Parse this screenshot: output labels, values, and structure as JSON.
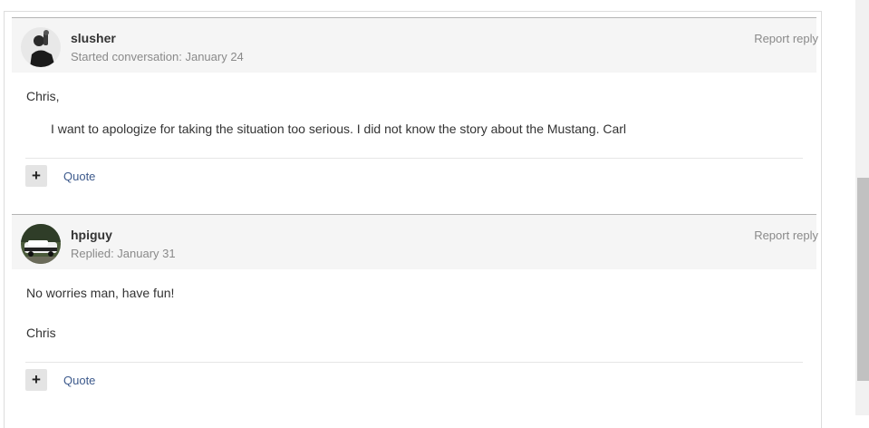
{
  "posts": [
    {
      "username": "slusher",
      "meta": "Started conversation: January 24",
      "report_label": "Report reply",
      "lines": [
        "Chris,"
      ],
      "quote": "I want to apologize for taking the situation too serious. I did not know the story about the Mustang. Carl",
      "plus_label": "+",
      "quote_label": "Quote"
    },
    {
      "username": "hpiguy",
      "meta": "Replied: January 31",
      "report_label": "Report reply",
      "lines": [
        "No worries man, have fun!",
        "Chris"
      ],
      "plus_label": "+",
      "quote_label": "Quote"
    }
  ],
  "colors": {
    "header_bg": "#f5f5f5",
    "link": "#3d5a8c",
    "muted": "#8a8a8a",
    "text": "#333333"
  }
}
